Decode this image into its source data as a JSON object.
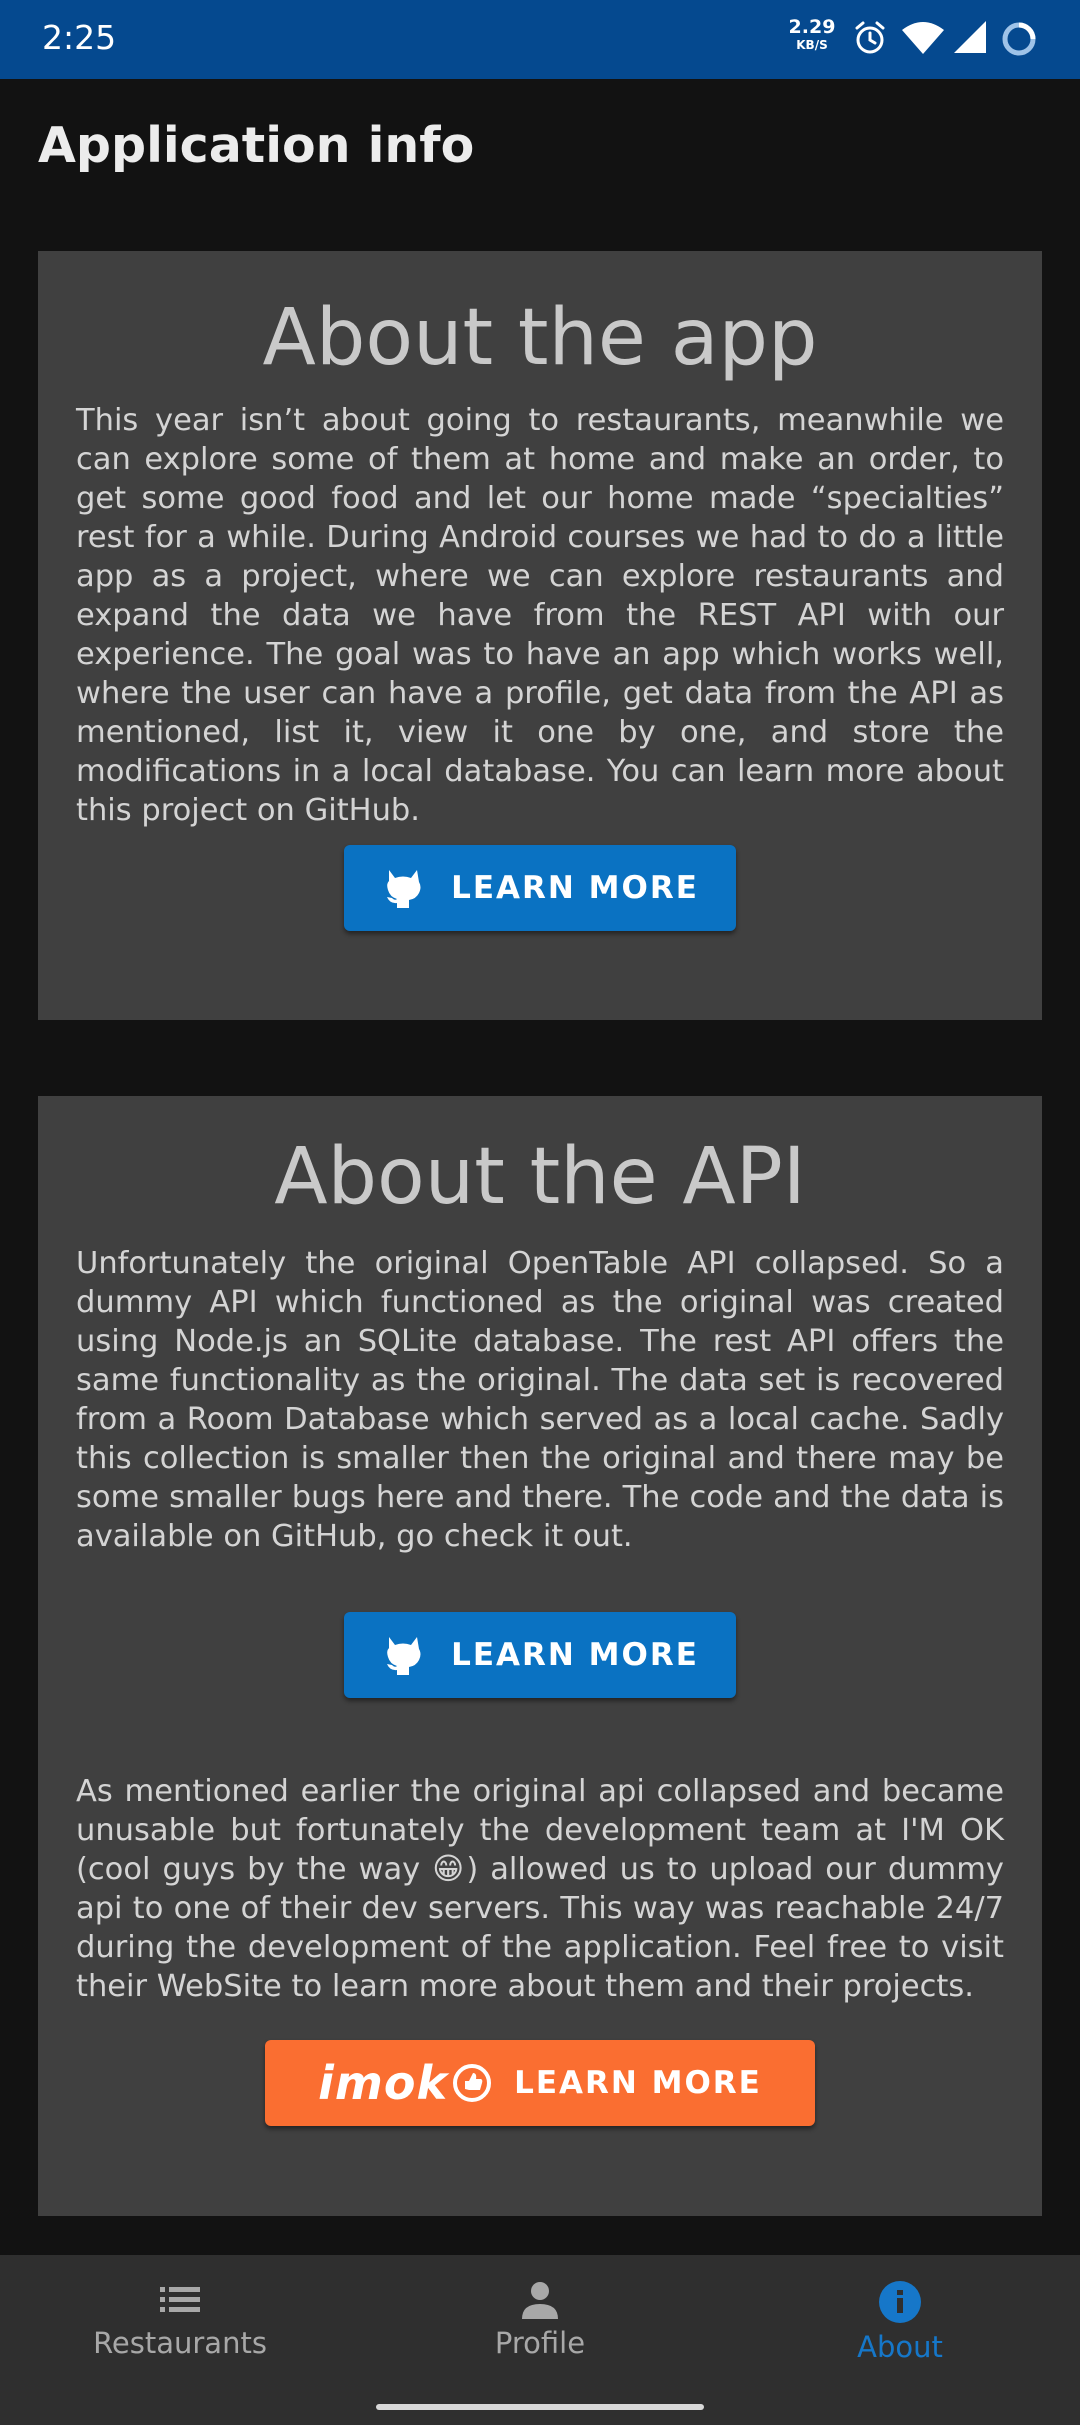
{
  "status_bar": {
    "time": "2:25",
    "net_speed": "2.29",
    "net_speed_unit": "KB/S",
    "icons": [
      "alarm-icon",
      "wifi-icon",
      "signal-icon",
      "loading-icon"
    ]
  },
  "page": {
    "title": "Application info"
  },
  "about_app": {
    "heading": "About the app",
    "text": "This year isn’t about going to restaurants, meanwhile we can explore some of them at home and make an order, to get some good food and let our home made “specialties” rest for a while. During Android courses we had to do a little app as a project, where we can explore restaurants and expand the data we have from the REST API with our experience. The goal was to have an app which works well, where the user can have a profile, get data from the API as mentioned, list it, view it one by one, and store the modifications in a local database. You can learn more about this project on GitHub.",
    "button_label": "LEARN MORE",
    "button_icon": "github-icon"
  },
  "about_api": {
    "heading": "About the API",
    "text": "Unfortunately the original OpenTable API collapsed. So a dummy API which functioned as the original was created using Node.js an SQLite database. The rest API offers the same functionality as the original. The data set is recovered from a Room Database which served as a local cache. Sadly this collection is smaller then the original and there may be some smaller bugs here and there. The code and the data is available on GitHub, go check it out.",
    "button_label": "LEARN MORE",
    "button_icon": "github-icon",
    "text2": "As mentioned earlier the original api collapsed and became unusable but fortunately the development team at I'M OK (cool guys by the way 😁) allowed us to upload our dummy api to one of their dev servers. This way was reachable 24/7 during the development of the application. Feel free to visit their WebSite to learn more about them and their projects.",
    "imok_logo_text": "imok",
    "imok_button_label": "LEARN MORE"
  },
  "bottom_nav": {
    "items": [
      {
        "label": "Restaurants",
        "icon": "list-icon",
        "active": false
      },
      {
        "label": "Profile",
        "icon": "person-icon",
        "active": false
      },
      {
        "label": "About",
        "icon": "info-icon",
        "active": true
      }
    ]
  },
  "colors": {
    "status_bar": "#05498f",
    "background": "#121212",
    "card": "#404040",
    "github_button": "#0a72c2",
    "imok_button": "#fa6e31",
    "nav_active": "#1677c9",
    "nav_inactive": "#a8a8a8"
  }
}
